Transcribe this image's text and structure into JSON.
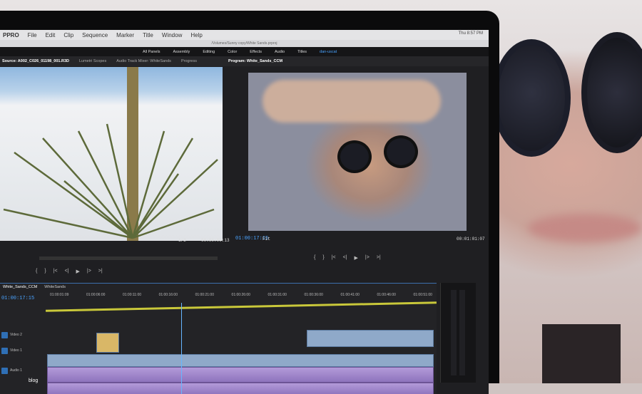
{
  "menu": {
    "app": "PPRO",
    "items": [
      "File",
      "Edit",
      "Clip",
      "Sequence",
      "Marker",
      "Title",
      "Window",
      "Help"
    ]
  },
  "status": {
    "clock": "Thu 8:57 PM"
  },
  "window_title": "/Volumes/Sunny copy/White Sands.prproj",
  "workspaces": [
    "All Panels",
    "Assembly",
    "Editing",
    "Color",
    "Effects",
    "Audio",
    "Titles",
    "dan-uscat"
  ],
  "workspace_active": 7,
  "panel_tabs": {
    "source": "Source: A002_C026_01198_001.R3D",
    "lumetri": "Lumetri Scopes",
    "audio_mixer": "Audio Track Mixer: WhiteSands",
    "progress": "Progress",
    "program": "Program: White_Sands_CCM"
  },
  "source_monitor": {
    "zoom": "1/2",
    "timecode": "00:00:00:13"
  },
  "program_monitor": {
    "timecode": "01:00:17:15",
    "zoom": "Fit",
    "duration": "00:01:01:07"
  },
  "transport": [
    "{",
    "}",
    "|<",
    "<|",
    "▶",
    "|>",
    ">|"
  ],
  "timeline": {
    "tabs": [
      "White_Sands_CCM",
      "WhiteSands"
    ],
    "timecode": "01:00:17:15",
    "ruler": [
      "01:00:01:09",
      "01:00:06:00",
      "01:00:11:00",
      "01:00:16:00",
      "01:00:21:00",
      "01:00:26:00",
      "01:00:31:00",
      "01:00:36:00",
      "01:00:41:00",
      "01:00:46:00",
      "01:00:51:00"
    ],
    "tracks": [
      {
        "name": "V2",
        "label": "Video 2"
      },
      {
        "name": "V1",
        "label": "Video 1"
      },
      {
        "name": "A1",
        "label": "Audio 1"
      }
    ]
  },
  "watermark": "blog",
  "colors": {
    "accent": "#4aa3ff",
    "audio_clip": "#a58ccf",
    "video_clip": "#8fa9c9",
    "work_area": "#c9c83a"
  }
}
